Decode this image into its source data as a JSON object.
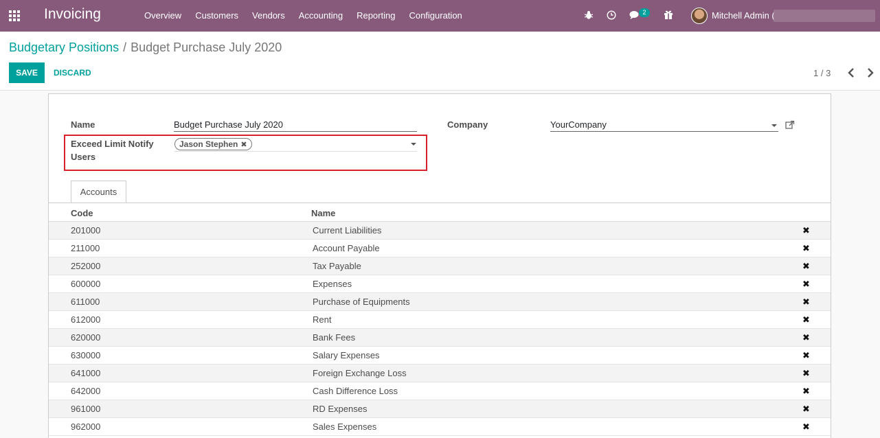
{
  "navbar": {
    "app_title": "Invoicing",
    "menu": [
      "Overview",
      "Customers",
      "Vendors",
      "Accounting",
      "Reporting",
      "Configuration"
    ],
    "messages_count": "2",
    "user_name": "Mitchell Admin (",
    "icons": [
      "apps-grid-icon",
      "bug-icon",
      "clock-icon",
      "chat-icon",
      "gift-icon"
    ],
    "accent_color": "#875a7b"
  },
  "breadcrumb": {
    "parent": "Budgetary Positions",
    "separator": "/",
    "current": "Budget Purchase July 2020"
  },
  "toolbar": {
    "save_label": "SAVE",
    "discard_label": "DISCARD",
    "pager": "1 / 3"
  },
  "form": {
    "name_label": "Name",
    "name_value": "Budget Purchase July 2020",
    "company_label": "Company",
    "company_value": "YourCompany",
    "notify_label_1": "Exceed Limit Notify",
    "notify_label_2": "Users",
    "notify_tags": [
      "Jason Stephen"
    ]
  },
  "tabs": [
    {
      "label": "Accounts",
      "active": true
    }
  ],
  "accounts_table": {
    "columns": [
      "Code",
      "Name"
    ],
    "rows": [
      {
        "code": "201000",
        "name": "Current Liabilities"
      },
      {
        "code": "211000",
        "name": "Account Payable"
      },
      {
        "code": "252000",
        "name": "Tax Payable"
      },
      {
        "code": "600000",
        "name": "Expenses"
      },
      {
        "code": "611000",
        "name": "Purchase of Equipments"
      },
      {
        "code": "612000",
        "name": "Rent"
      },
      {
        "code": "620000",
        "name": "Bank Fees"
      },
      {
        "code": "630000",
        "name": "Salary Expenses"
      },
      {
        "code": "641000",
        "name": "Foreign Exchange Loss"
      },
      {
        "code": "642000",
        "name": "Cash Difference Loss"
      },
      {
        "code": "961000",
        "name": "RD Expenses"
      },
      {
        "code": "962000",
        "name": "Sales Expenses"
      }
    ]
  },
  "colors": {
    "primary": "#00a09d",
    "highlight_border": "#d9202a"
  }
}
